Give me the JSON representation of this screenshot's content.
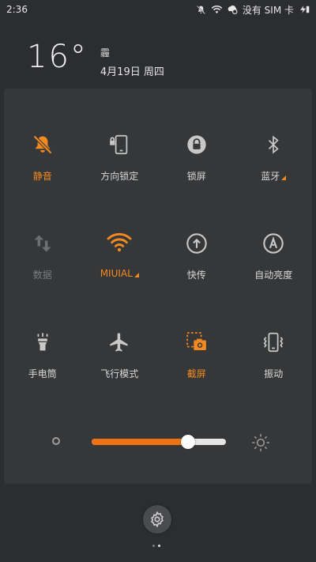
{
  "status_bar": {
    "time": "2:36",
    "no_sim": "没有 SIM 卡"
  },
  "header": {
    "temperature": "16°",
    "weather": "霾",
    "date": "4月19日 周四"
  },
  "toggles": [
    {
      "label": "静音",
      "icon": "silent-bell-icon",
      "state": "on"
    },
    {
      "label": "方向锁定",
      "icon": "rotation-lock-icon",
      "state": "off"
    },
    {
      "label": "锁屏",
      "icon": "lock-icon",
      "state": "off"
    },
    {
      "label": "蓝牙",
      "icon": "bluetooth-icon",
      "state": "off",
      "has_menu": true
    },
    {
      "label": "数据",
      "icon": "data-icon",
      "state": "disabled"
    },
    {
      "label": "MIUIAL",
      "icon": "wifi-icon",
      "state": "on",
      "has_menu": true
    },
    {
      "label": "快传",
      "icon": "quick-transfer-icon",
      "state": "off"
    },
    {
      "label": "自动亮度",
      "icon": "auto-brightness-icon",
      "state": "off"
    },
    {
      "label": "手电筒",
      "icon": "flashlight-icon",
      "state": "off"
    },
    {
      "label": "飞行模式",
      "icon": "airplane-icon",
      "state": "off"
    },
    {
      "label": "截屏",
      "icon": "screenshot-icon",
      "state": "on"
    },
    {
      "label": "振动",
      "icon": "vibrate-icon",
      "state": "off"
    }
  ],
  "brightness": {
    "level_percent": 72
  },
  "colors": {
    "accent": "#f28a21",
    "panel": "#363739",
    "background": "#2c2d30"
  }
}
